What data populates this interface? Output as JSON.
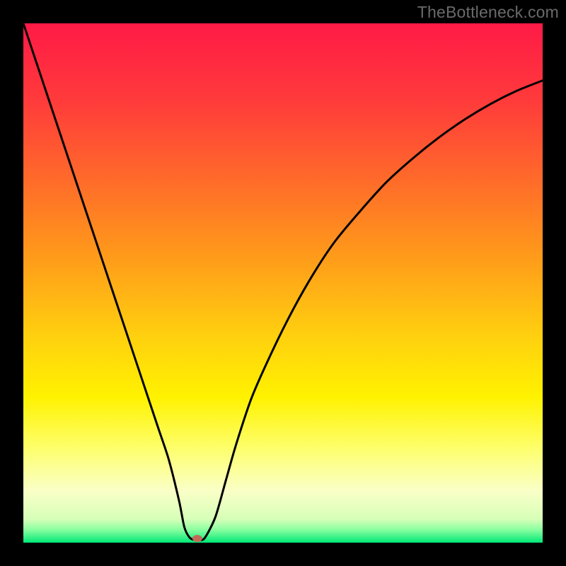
{
  "watermark": "TheBottleneck.com",
  "chart_data": {
    "type": "line",
    "title": "",
    "xlabel": "",
    "ylabel": "",
    "xlim": [
      0,
      100
    ],
    "ylim": [
      0,
      100
    ],
    "grid": false,
    "legend": false,
    "gradient_stops": [
      {
        "offset": 0.0,
        "color": "#ff1a46"
      },
      {
        "offset": 0.15,
        "color": "#ff3b3b"
      },
      {
        "offset": 0.3,
        "color": "#ff6a2a"
      },
      {
        "offset": 0.45,
        "color": "#ff9b1a"
      },
      {
        "offset": 0.6,
        "color": "#ffcf0f"
      },
      {
        "offset": 0.72,
        "color": "#fff200"
      },
      {
        "offset": 0.82,
        "color": "#fdff6e"
      },
      {
        "offset": 0.9,
        "color": "#faffc7"
      },
      {
        "offset": 0.955,
        "color": "#d6ffb8"
      },
      {
        "offset": 0.975,
        "color": "#8affa0"
      },
      {
        "offset": 1.0,
        "color": "#00e877"
      }
    ],
    "series": [
      {
        "name": "bottleneck-curve",
        "x": [
          0,
          2,
          4,
          6,
          8,
          10,
          12,
          14,
          16,
          18,
          20,
          22,
          24,
          26,
          28,
          30,
          31,
          32,
          33,
          34,
          35,
          37,
          39,
          41,
          44,
          48,
          52,
          56,
          60,
          65,
          70,
          75,
          80,
          85,
          90,
          95,
          100
        ],
        "y": [
          100,
          94,
          88,
          82,
          76,
          70,
          64,
          58,
          52,
          46,
          40,
          34,
          28,
          22,
          16,
          8,
          3,
          1.0,
          0.5,
          0.5,
          1.0,
          5,
          12,
          19,
          28,
          37,
          45,
          52,
          58,
          64,
          69.5,
          74,
          78,
          81.5,
          84.5,
          87,
          89
        ]
      }
    ],
    "markers": [
      {
        "name": "minimum-point",
        "x": 33.5,
        "y": 0.8,
        "color": "#c26a5a",
        "rx": 7,
        "ry": 5
      }
    ]
  }
}
